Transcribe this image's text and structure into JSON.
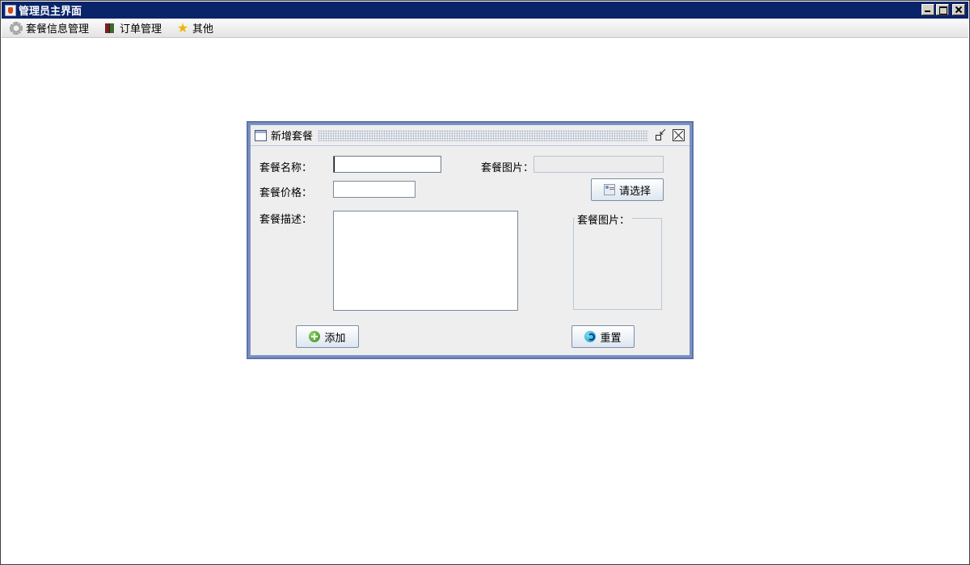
{
  "window": {
    "title": "管理员主界面",
    "controls": [
      "minimize",
      "maximize",
      "close"
    ]
  },
  "menubar": {
    "items": [
      {
        "label": "套餐信息管理",
        "icon": "gear-icon"
      },
      {
        "label": "订单管理",
        "icon": "books-icon"
      },
      {
        "label": "其他",
        "icon": "star-icon"
      }
    ]
  },
  "internal_frame": {
    "title": "新增套餐",
    "form": {
      "name_label": "套餐名称：",
      "name_value": "",
      "price_label": "套餐价格：",
      "price_value": "",
      "desc_label": "套餐描述：",
      "desc_value": "",
      "image_label": "套餐图片：",
      "image_path_value": "",
      "choose_button": "请选择",
      "image_group_caption": "套餐图片："
    },
    "buttons": {
      "add": "添加",
      "reset": "重置"
    }
  },
  "colors": {
    "titlebar": "#0a246a",
    "frame_border": "#7b90c3",
    "frame_background": "#eeeeee"
  }
}
